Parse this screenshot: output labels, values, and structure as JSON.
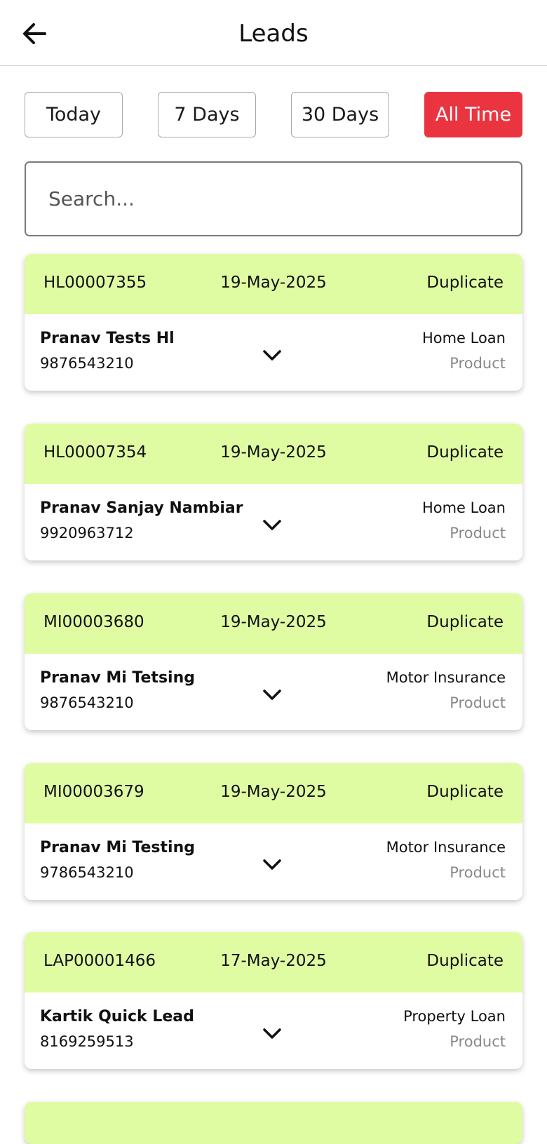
{
  "header": {
    "title": "Leads",
    "back_icon": "arrow-left-icon"
  },
  "filters": {
    "options": [
      "Today",
      "7 Days",
      "30 Days",
      "All Time"
    ],
    "selected": "All Time",
    "active_color": "#ea3540"
  },
  "search": {
    "placeholder": "Search...",
    "value": ""
  },
  "colors": {
    "card_header": "#e0fca3",
    "muted_text": "#888888"
  },
  "leads": [
    {
      "id": "HL00007355",
      "date": "19-May-2025",
      "status": "Duplicate",
      "name": "Pranav Tests Hl",
      "phone": "9876543210",
      "product": "Home Loan",
      "product_label": "Product"
    },
    {
      "id": "HL00007354",
      "date": "19-May-2025",
      "status": "Duplicate",
      "name": "Pranav Sanjay Nambiar",
      "phone": "9920963712",
      "product": "Home Loan",
      "product_label": "Product"
    },
    {
      "id": "MI00003680",
      "date": "19-May-2025",
      "status": "Duplicate",
      "name": "Pranav Mi Tetsing",
      "phone": "9876543210",
      "product": "Motor Insurance",
      "product_label": "Product"
    },
    {
      "id": "MI00003679",
      "date": "19-May-2025",
      "status": "Duplicate",
      "name": "Pranav Mi Testing",
      "phone": "9786543210",
      "product": "Motor Insurance",
      "product_label": "Product"
    },
    {
      "id": "LAP00001466",
      "date": "17-May-2025",
      "status": "Duplicate",
      "name": "Kartik Quick Lead",
      "phone": "8169259513",
      "product": "Property Loan",
      "product_label": "Product"
    }
  ]
}
